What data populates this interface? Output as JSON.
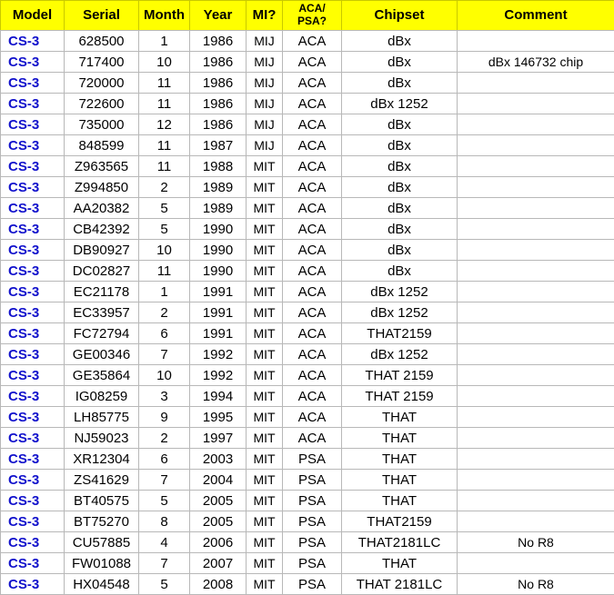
{
  "table": {
    "columns": [
      {
        "key": "model",
        "label": "Model",
        "two_line": false
      },
      {
        "key": "serial",
        "label": "Serial",
        "two_line": false
      },
      {
        "key": "month",
        "label": "Month",
        "two_line": false
      },
      {
        "key": "year",
        "label": "Year",
        "two_line": false
      },
      {
        "key": "mi",
        "label": "MI?",
        "two_line": false
      },
      {
        "key": "acapsa",
        "label": "ACA/\nPSA?",
        "two_line": true
      },
      {
        "key": "chipset",
        "label": "Chipset",
        "two_line": false
      },
      {
        "key": "comment",
        "label": "Comment",
        "two_line": false
      }
    ],
    "header_background": "#ffff00",
    "model_color": "#1111cc",
    "grid_color": "#b8b8b8",
    "rows": [
      {
        "model": "CS-3",
        "serial": "628500",
        "month": "1",
        "year": "1986",
        "mi": "MIJ",
        "acapsa": "ACA",
        "chipset": "dBx",
        "comment": ""
      },
      {
        "model": "CS-3",
        "serial": "717400",
        "month": "10",
        "year": "1986",
        "mi": "MIJ",
        "acapsa": "ACA",
        "chipset": "dBx",
        "comment": "dBx 146732 chip"
      },
      {
        "model": "CS-3",
        "serial": "720000",
        "month": "11",
        "year": "1986",
        "mi": "MIJ",
        "acapsa": "ACA",
        "chipset": "dBx",
        "comment": ""
      },
      {
        "model": "CS-3",
        "serial": "722600",
        "month": "11",
        "year": "1986",
        "mi": "MIJ",
        "acapsa": "ACA",
        "chipset": "dBx 1252",
        "comment": ""
      },
      {
        "model": "CS-3",
        "serial": "735000",
        "month": "12",
        "year": "1986",
        "mi": "MIJ",
        "acapsa": "ACA",
        "chipset": "dBx",
        "comment": ""
      },
      {
        "model": "CS-3",
        "serial": "848599",
        "month": "11",
        "year": "1987",
        "mi": "MIJ",
        "acapsa": "ACA",
        "chipset": "dBx",
        "comment": ""
      },
      {
        "model": "CS-3",
        "serial": "Z963565",
        "month": "11",
        "year": "1988",
        "mi": "MIT",
        "acapsa": "ACA",
        "chipset": "dBx",
        "comment": ""
      },
      {
        "model": "CS-3",
        "serial": "Z994850",
        "month": "2",
        "year": "1989",
        "mi": "MIT",
        "acapsa": "ACA",
        "chipset": "dBx",
        "comment": ""
      },
      {
        "model": "CS-3",
        "serial": "AA20382",
        "month": "5",
        "year": "1989",
        "mi": "MIT",
        "acapsa": "ACA",
        "chipset": "dBx",
        "comment": ""
      },
      {
        "model": "CS-3",
        "serial": "CB42392",
        "month": "5",
        "year": "1990",
        "mi": "MIT",
        "acapsa": "ACA",
        "chipset": "dBx",
        "comment": ""
      },
      {
        "model": "CS-3",
        "serial": "DB90927",
        "month": "10",
        "year": "1990",
        "mi": "MIT",
        "acapsa": "ACA",
        "chipset": "dBx",
        "comment": ""
      },
      {
        "model": "CS-3",
        "serial": "DC02827",
        "month": "11",
        "year": "1990",
        "mi": "MIT",
        "acapsa": "ACA",
        "chipset": "dBx",
        "comment": ""
      },
      {
        "model": "CS-3",
        "serial": "EC21178",
        "month": "1",
        "year": "1991",
        "mi": "MIT",
        "acapsa": "ACA",
        "chipset": "dBx 1252",
        "comment": ""
      },
      {
        "model": "CS-3",
        "serial": "EC33957",
        "month": "2",
        "year": "1991",
        "mi": "MIT",
        "acapsa": "ACA",
        "chipset": "dBx 1252",
        "comment": ""
      },
      {
        "model": "CS-3",
        "serial": "FC72794",
        "month": "6",
        "year": "1991",
        "mi": "MIT",
        "acapsa": "ACA",
        "chipset": "THAT2159",
        "comment": ""
      },
      {
        "model": "CS-3",
        "serial": "GE00346",
        "month": "7",
        "year": "1992",
        "mi": "MIT",
        "acapsa": "ACA",
        "chipset": "dBx 1252",
        "comment": ""
      },
      {
        "model": "CS-3",
        "serial": "GE35864",
        "month": "10",
        "year": "1992",
        "mi": "MIT",
        "acapsa": "ACA",
        "chipset": "THAT 2159",
        "comment": ""
      },
      {
        "model": "CS-3",
        "serial": "IG08259",
        "month": "3",
        "year": "1994",
        "mi": "MIT",
        "acapsa": "ACA",
        "chipset": "THAT 2159",
        "comment": ""
      },
      {
        "model": "CS-3",
        "serial": "LH85775",
        "month": "9",
        "year": "1995",
        "mi": "MIT",
        "acapsa": "ACA",
        "chipset": "THAT",
        "comment": ""
      },
      {
        "model": "CS-3",
        "serial": "NJ59023",
        "month": "2",
        "year": "1997",
        "mi": "MIT",
        "acapsa": "ACA",
        "chipset": "THAT",
        "comment": ""
      },
      {
        "model": "CS-3",
        "serial": "XR12304",
        "month": "6",
        "year": "2003",
        "mi": "MIT",
        "acapsa": "PSA",
        "chipset": "THAT",
        "comment": ""
      },
      {
        "model": "CS-3",
        "serial": "ZS41629",
        "month": "7",
        "year": "2004",
        "mi": "MIT",
        "acapsa": "PSA",
        "chipset": "THAT",
        "comment": ""
      },
      {
        "model": "CS-3",
        "serial": "BT40575",
        "month": "5",
        "year": "2005",
        "mi": "MIT",
        "acapsa": "PSA",
        "chipset": "THAT",
        "comment": ""
      },
      {
        "model": "CS-3",
        "serial": "BT75270",
        "month": "8",
        "year": "2005",
        "mi": "MIT",
        "acapsa": "PSA",
        "chipset": "THAT2159",
        "comment": ""
      },
      {
        "model": "CS-3",
        "serial": "CU57885",
        "month": "4",
        "year": "2006",
        "mi": "MIT",
        "acapsa": "PSA",
        "chipset": "THAT2181LC",
        "comment": "No R8"
      },
      {
        "model": "CS-3",
        "serial": "FW01088",
        "month": "7",
        "year": "2007",
        "mi": "MIT",
        "acapsa": "PSA",
        "chipset": "THAT",
        "comment": ""
      },
      {
        "model": "CS-3",
        "serial": "HX04548",
        "month": "5",
        "year": "2008",
        "mi": "MIT",
        "acapsa": "PSA",
        "chipset": "THAT 2181LC",
        "comment": "No R8"
      }
    ]
  }
}
